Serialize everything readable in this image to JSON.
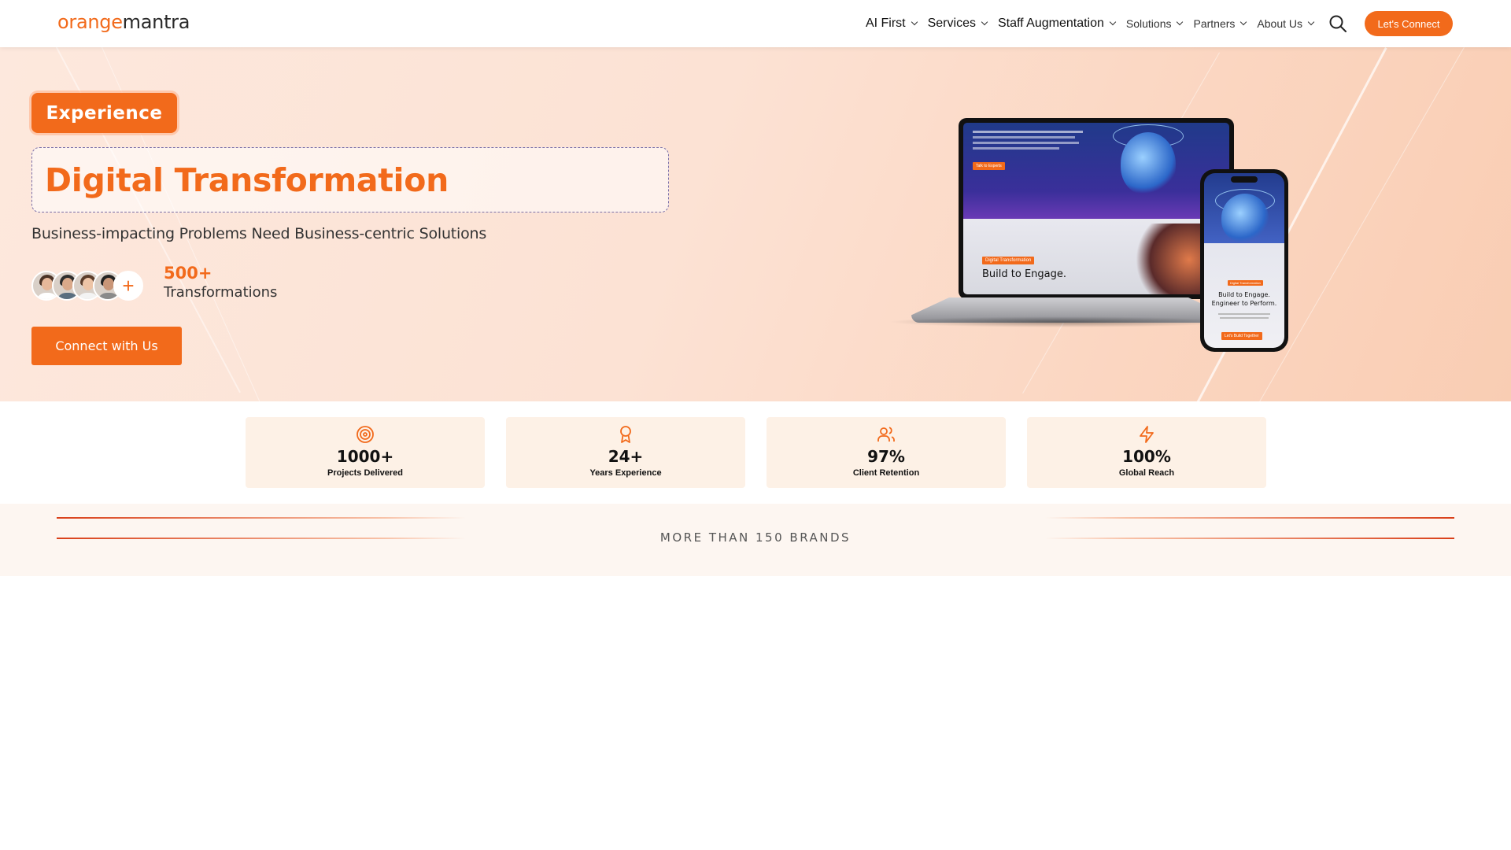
{
  "nav": {
    "logo_part1": "orange",
    "logo_part2": "mantra",
    "items": [
      {
        "label": "AI First"
      },
      {
        "label": "Services"
      },
      {
        "label": "Staff Augmentation"
      },
      {
        "label": "Solutions"
      },
      {
        "label": "Partners"
      },
      {
        "label": "About Us"
      }
    ],
    "cta_label": "Let's Connect",
    "search_icon": "search-icon"
  },
  "hero": {
    "badge": "Experience",
    "title": "Digital Transformation",
    "subtitle": "Business-impacting Problems Need Business-centric Solutions",
    "count": "500+",
    "count_label": "Transformations",
    "plus": "+",
    "button_label": "Connect with Us",
    "mockup": {
      "laptop_tag": "Digital Transformation",
      "laptop_heading": "Build to Engage.",
      "laptop_cta": "Talk to Experts",
      "phone_tag": "Digital Transformation",
      "phone_heading_1": "Build to Engage.",
      "phone_heading_2": "Engineer to Perform.",
      "phone_cta": "Let's Build Together"
    }
  },
  "stats": [
    {
      "icon": "target-icon",
      "value": "1000+",
      "label": "Projects Delivered"
    },
    {
      "icon": "award-icon",
      "value": "24+",
      "label": "Years Experience"
    },
    {
      "icon": "users-icon",
      "value": "97%",
      "label": "Client Retention"
    },
    {
      "icon": "lightning-icon",
      "value": "100%",
      "label": "Global Reach"
    }
  ],
  "brands": {
    "title": "MORE THAN 150 BRANDS"
  },
  "colors": {
    "accent": "#f26a1b",
    "stat_bg": "#fdf1e6",
    "hero_bg": "#fce2d4"
  }
}
